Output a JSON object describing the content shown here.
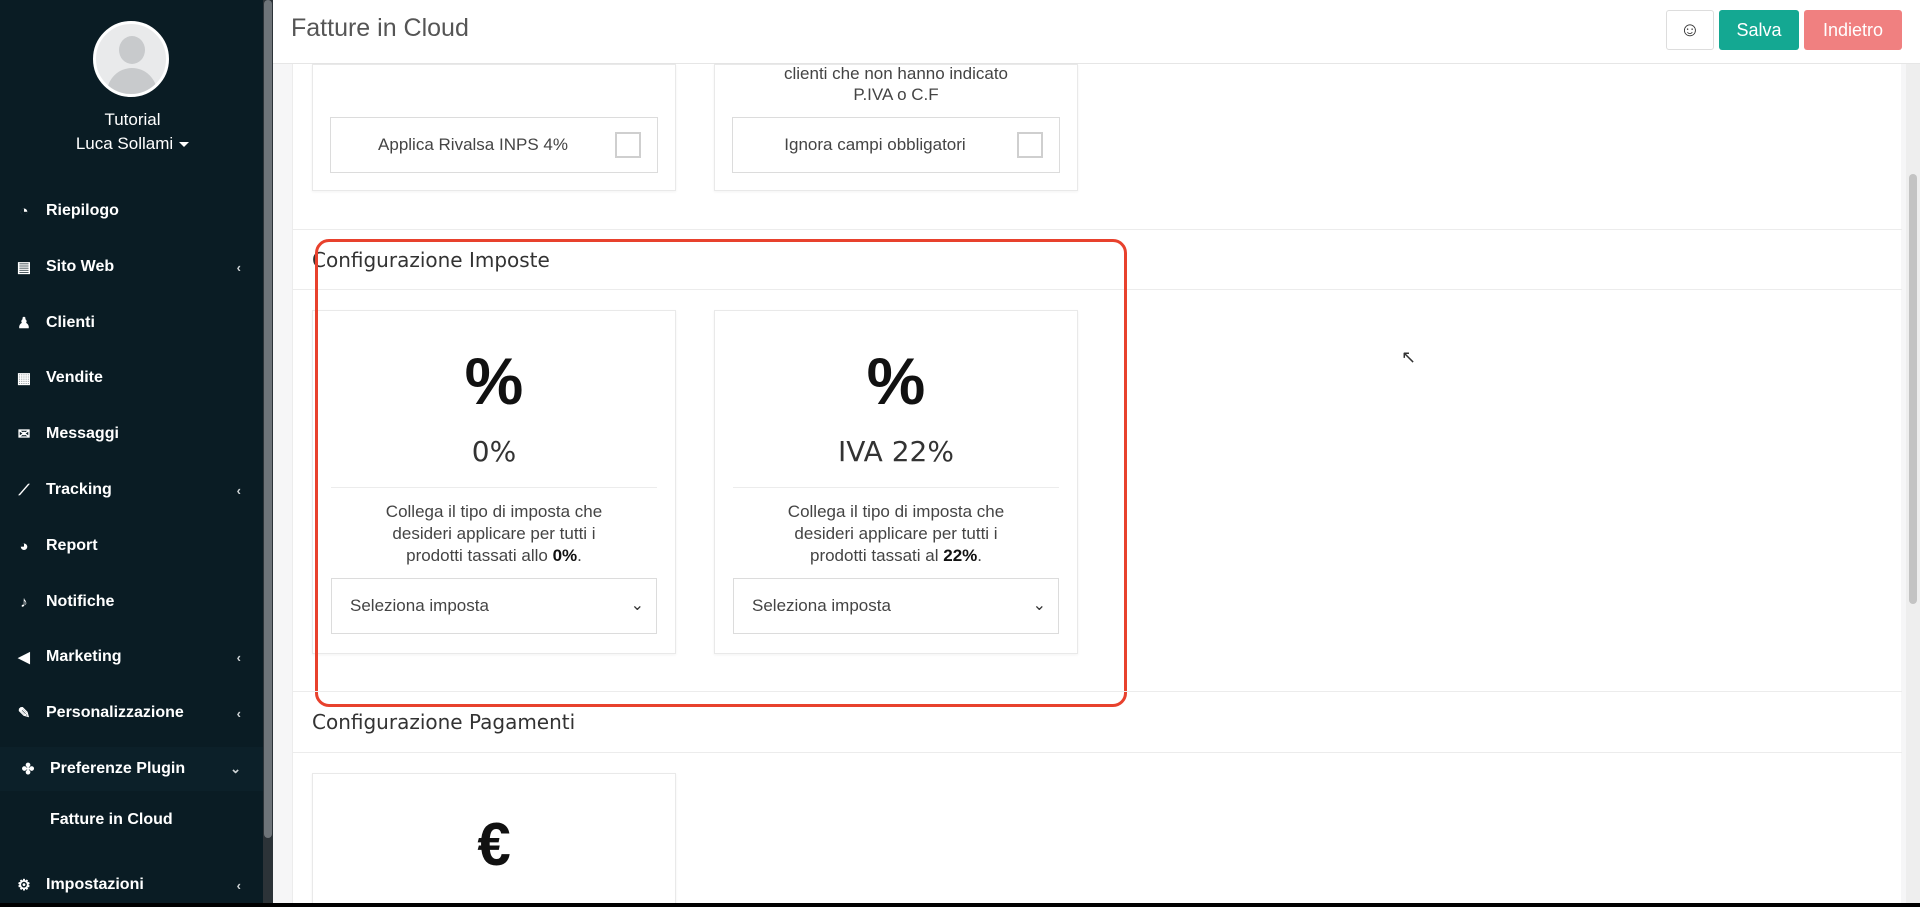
{
  "user": {
    "line1": "Tutorial",
    "line2": "Luca Sollami"
  },
  "nav": [
    {
      "label": "Riepilogo",
      "icon": "dashboard-icon",
      "glyph": "◔",
      "chevron": ""
    },
    {
      "label": "Sito Web",
      "icon": "file-icon",
      "glyph": "▤",
      "chevron": "‹"
    },
    {
      "label": "Clienti",
      "icon": "person-icon",
      "glyph": "♟",
      "chevron": ""
    },
    {
      "label": "Vendite",
      "icon": "calculator-icon",
      "glyph": "▦",
      "chevron": ""
    },
    {
      "label": "Messaggi",
      "icon": "envelope-icon",
      "glyph": "✉",
      "chevron": ""
    },
    {
      "label": "Tracking",
      "icon": "chart-line-icon",
      "glyph": "⟋",
      "chevron": "‹"
    },
    {
      "label": "Report",
      "icon": "pie-chart-icon",
      "glyph": "◕",
      "chevron": ""
    },
    {
      "label": "Notifiche",
      "icon": "bell-icon",
      "glyph": "♪",
      "chevron": ""
    },
    {
      "label": "Marketing",
      "icon": "megaphone-icon",
      "glyph": "◀",
      "chevron": "‹"
    },
    {
      "label": "Personalizzazione",
      "icon": "brush-icon",
      "glyph": "✎",
      "chevron": "‹"
    },
    {
      "label": "Preferenze Plugin",
      "icon": "cubes-icon",
      "glyph": "✤",
      "chevron": "⌄"
    },
    {
      "label": "Impostazioni",
      "icon": "gear-icon",
      "glyph": "⚙",
      "chevron": "‹"
    }
  ],
  "nav_sub": "Fatture in Cloud",
  "header": {
    "title": "Fatture in Cloud",
    "emoji": "☺",
    "save_label": "Salva",
    "back_label": "Indietro"
  },
  "top_cards": {
    "rivalsa_label": "Applica Rivalsa INPS 4%",
    "note_line1": "clienti che non hanno indicato",
    "note_line2": "P.IVA o C.F",
    "ignore_label": "Ignora campi obbligatori"
  },
  "imposte": {
    "title": "Configurazione Imposte",
    "cards": [
      {
        "symbol": "%",
        "value": "0%",
        "desc_line1": "Collega il tipo di imposta che",
        "desc_line2": "desideri applicare per tutti i",
        "desc_line3a": "prodotti tassati allo ",
        "desc_bold": "0%",
        "desc_line3c": ".",
        "select": "Seleziona imposta"
      },
      {
        "symbol": "%",
        "value": "IVA 22%",
        "desc_line1": "Collega il tipo di imposta che",
        "desc_line2": "desideri applicare per tutti i",
        "desc_line3a": "prodotti tassati al ",
        "desc_bold": "22%",
        "desc_line3c": ".",
        "select": "Seleziona imposta"
      }
    ]
  },
  "pagamenti": {
    "title": "Configurazione Pagamenti",
    "symbol": "€"
  },
  "colors": {
    "sidebar": "#0a1c24",
    "save": "#14a892",
    "back": "#f08080",
    "highlight": "#e8412d"
  }
}
